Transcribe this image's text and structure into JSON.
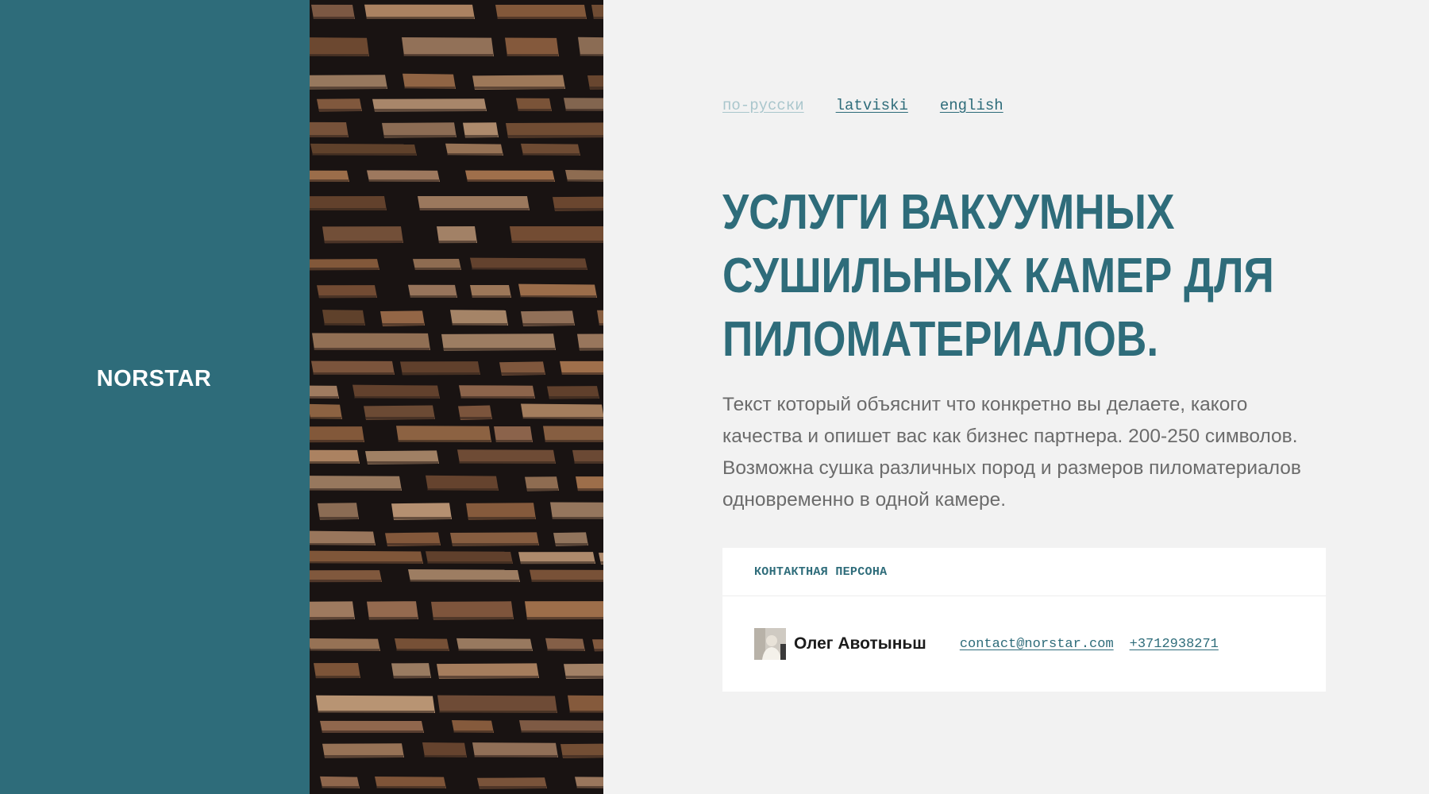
{
  "brand": {
    "name": "NORSTAR",
    "panel_color": "#2e6c7a"
  },
  "photo": {
    "subject": "stacked lumber boards"
  },
  "languages": [
    {
      "label": "по-русски",
      "active": true
    },
    {
      "label": "latviski",
      "active": false
    },
    {
      "label": "english",
      "active": false
    }
  ],
  "hero": {
    "headline_lines": [
      "УСЛУГИ ВАКУУМНЫХ",
      "СУШИЛЬНЫХ КАМЕР ДЛЯ",
      "ПИЛОМАТЕРИАЛОВ."
    ],
    "lead_lines": [
      "Текст который объяснит что конкретно вы делаете, какого",
      "качества и опишет вас как бизнес партнера. 200-250 символов.",
      "Возможна сушка различных пород и размеров пиломатериалов",
      "одновременно в одной камере."
    ]
  },
  "contact": {
    "title": "КОНТАКТНАЯ ПЕРСОНА",
    "name": "Олег Авотыньш",
    "email": "contact@norstar.com",
    "phone": "+3712938271"
  },
  "colors": {
    "accent": "#2e6c7a",
    "background": "#f2f2f2",
    "muted_text": "#6b6b6b",
    "inactive_link": "#a9c6cc"
  }
}
